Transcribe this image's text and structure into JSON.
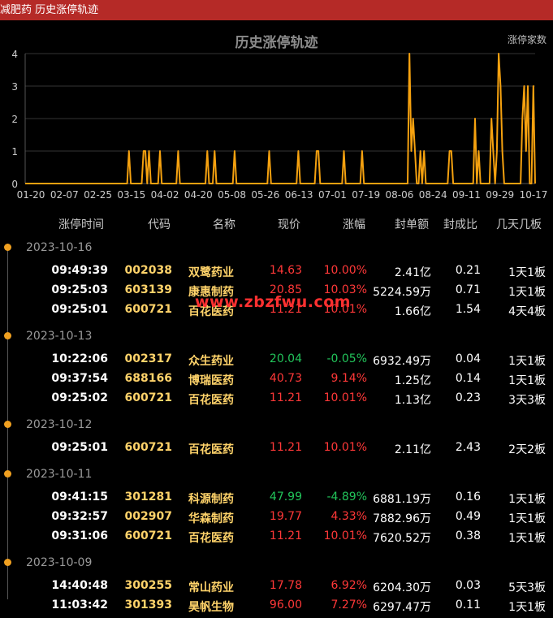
{
  "window": {
    "title": "减肥药 历史涨停轨迹"
  },
  "chart_data": {
    "type": "line",
    "title": "历史涨停轨迹",
    "series": [
      {
        "name": "涨停家数",
        "values": [
          0,
          0,
          0,
          0,
          0,
          0,
          0,
          0,
          0,
          0,
          0,
          0,
          0,
          0,
          0,
          0,
          0,
          0,
          0,
          0,
          0,
          0,
          0,
          0,
          0,
          0,
          0,
          0,
          0,
          0,
          0,
          0,
          0,
          0,
          0,
          0,
          0,
          0,
          0,
          0,
          0,
          0,
          0,
          0,
          0,
          0,
          0,
          0,
          0,
          0,
          0,
          0,
          0,
          0,
          0,
          0,
          0,
          1,
          0,
          0,
          0,
          0,
          0,
          0,
          0,
          1,
          1,
          0,
          1,
          0,
          0,
          0,
          0,
          0,
          1,
          0,
          0,
          0,
          0,
          0,
          0,
          0,
          0,
          0,
          1,
          0,
          0,
          0,
          0,
          0,
          0,
          0,
          0,
          0,
          0,
          0,
          0,
          0,
          0,
          0,
          1,
          0,
          0,
          0,
          1,
          0,
          0,
          0,
          0,
          0,
          0,
          0,
          0,
          0,
          0,
          1,
          0,
          0,
          0,
          0,
          0,
          0,
          0,
          0,
          0,
          0,
          0,
          0,
          0,
          0,
          0,
          0,
          0,
          0,
          1,
          0,
          0,
          0,
          0,
          0,
          0,
          0,
          0,
          0,
          0,
          0,
          0,
          0,
          0,
          0,
          1,
          0,
          0,
          0,
          0,
          0,
          0,
          0,
          0,
          0,
          1,
          1,
          0,
          0,
          0,
          0,
          0,
          0,
          0,
          0,
          0,
          0,
          0,
          0,
          0,
          1,
          0,
          0,
          0,
          0,
          0,
          0,
          0,
          0,
          0,
          1,
          0,
          0,
          0,
          0,
          0,
          0,
          0,
          0,
          0,
          0,
          0,
          0,
          0,
          0,
          0,
          0,
          0,
          0,
          0,
          0,
          0,
          0,
          0,
          0,
          0,
          4,
          1,
          2,
          1,
          0,
          0,
          1,
          0,
          1,
          0,
          0,
          0,
          0,
          0,
          0,
          0,
          0,
          0,
          0,
          0,
          0,
          0,
          1,
          1,
          0,
          0,
          0,
          0,
          0,
          0,
          0,
          0,
          0,
          0,
          0,
          0,
          2,
          0,
          1,
          0,
          0,
          0,
          0,
          0,
          0,
          2,
          1,
          0,
          1,
          4,
          3,
          1,
          0,
          0,
          0,
          0,
          0,
          0,
          0,
          0,
          0,
          0,
          2,
          3,
          1,
          3,
          0,
          0,
          3,
          0
        ]
      }
    ],
    "x_tick_labels": [
      "01-20",
      "02-07",
      "02-25",
      "03-15",
      "04-02",
      "04-20",
      "05-08",
      "05-26",
      "06-13",
      "07-01",
      "07-19",
      "08-06",
      "08-24",
      "09-11",
      "09-29",
      "10-17"
    ],
    "y_tick_labels": [
      "0",
      "1",
      "2",
      "3",
      "4"
    ],
    "ylim": [
      0,
      4
    ],
    "legend_label": "涨停家数",
    "grid": true,
    "colors": {
      "line": "#f5a10f",
      "grid": "#333333",
      "axis": "#555555"
    }
  },
  "table": {
    "headers": [
      "涨停时间",
      "代码",
      "名称",
      "现价",
      "涨幅",
      "封单额",
      "封成比",
      "几天几板"
    ],
    "groups": [
      {
        "date": "2023-10-16",
        "rows": [
          {
            "time": "09:49:39",
            "code": "002038",
            "name": "双鹭药业",
            "price": "14.63",
            "pct": "10.00%",
            "amt": "2.41亿",
            "ratio": "0.21",
            "days": "1天1板",
            "up": true
          },
          {
            "time": "09:25:03",
            "code": "603139",
            "name": "康惠制药",
            "price": "20.85",
            "pct": "10.03%",
            "amt": "5224.59万",
            "ratio": "0.71",
            "days": "1天1板",
            "up": true
          },
          {
            "time": "09:25:01",
            "code": "600721",
            "name": "百花医药",
            "price": "11.21",
            "pct": "10.01%",
            "amt": "1.66亿",
            "ratio": "1.54",
            "days": "4天4板",
            "up": true
          }
        ]
      },
      {
        "date": "2023-10-13",
        "rows": [
          {
            "time": "10:22:06",
            "code": "002317",
            "name": "众生药业",
            "price": "20.04",
            "pct": "-0.05%",
            "amt": "6932.49万",
            "ratio": "0.04",
            "days": "1天1板",
            "up": false
          },
          {
            "time": "09:37:54",
            "code": "688166",
            "name": "博瑞医药",
            "price": "40.73",
            "pct": "9.14%",
            "amt": "1.25亿",
            "ratio": "0.14",
            "days": "1天1板",
            "up": true
          },
          {
            "time": "09:25:02",
            "code": "600721",
            "name": "百花医药",
            "price": "11.21",
            "pct": "10.01%",
            "amt": "1.13亿",
            "ratio": "0.23",
            "days": "3天3板",
            "up": true
          }
        ]
      },
      {
        "date": "2023-10-12",
        "rows": [
          {
            "time": "09:25:01",
            "code": "600721",
            "name": "百花医药",
            "price": "11.21",
            "pct": "10.01%",
            "amt": "2.11亿",
            "ratio": "2.43",
            "days": "2天2板",
            "up": true
          }
        ]
      },
      {
        "date": "2023-10-11",
        "rows": [
          {
            "time": "09:41:15",
            "code": "301281",
            "name": "科源制药",
            "price": "47.99",
            "pct": "-4.89%",
            "amt": "6881.19万",
            "ratio": "0.16",
            "days": "1天1板",
            "up": false
          },
          {
            "time": "09:32:57",
            "code": "002907",
            "name": "华森制药",
            "price": "19.77",
            "pct": "4.33%",
            "amt": "7882.96万",
            "ratio": "0.49",
            "days": "1天1板",
            "up": true
          },
          {
            "time": "09:31:06",
            "code": "600721",
            "name": "百花医药",
            "price": "11.21",
            "pct": "10.01%",
            "amt": "7620.52万",
            "ratio": "0.38",
            "days": "1天1板",
            "up": true
          }
        ]
      },
      {
        "date": "2023-10-09",
        "rows": [
          {
            "time": "14:40:48",
            "code": "300255",
            "name": "常山药业",
            "price": "17.78",
            "pct": "6.92%",
            "amt": "6204.30万",
            "ratio": "0.03",
            "days": "5天3板",
            "up": true
          },
          {
            "time": "11:03:42",
            "code": "301393",
            "name": "昊帆生物",
            "price": "96.00",
            "pct": "7.27%",
            "amt": "6297.47万",
            "ratio": "0.11",
            "days": "1天1板",
            "up": true
          }
        ]
      }
    ]
  },
  "watermark": "www.zbzfwu.com"
}
